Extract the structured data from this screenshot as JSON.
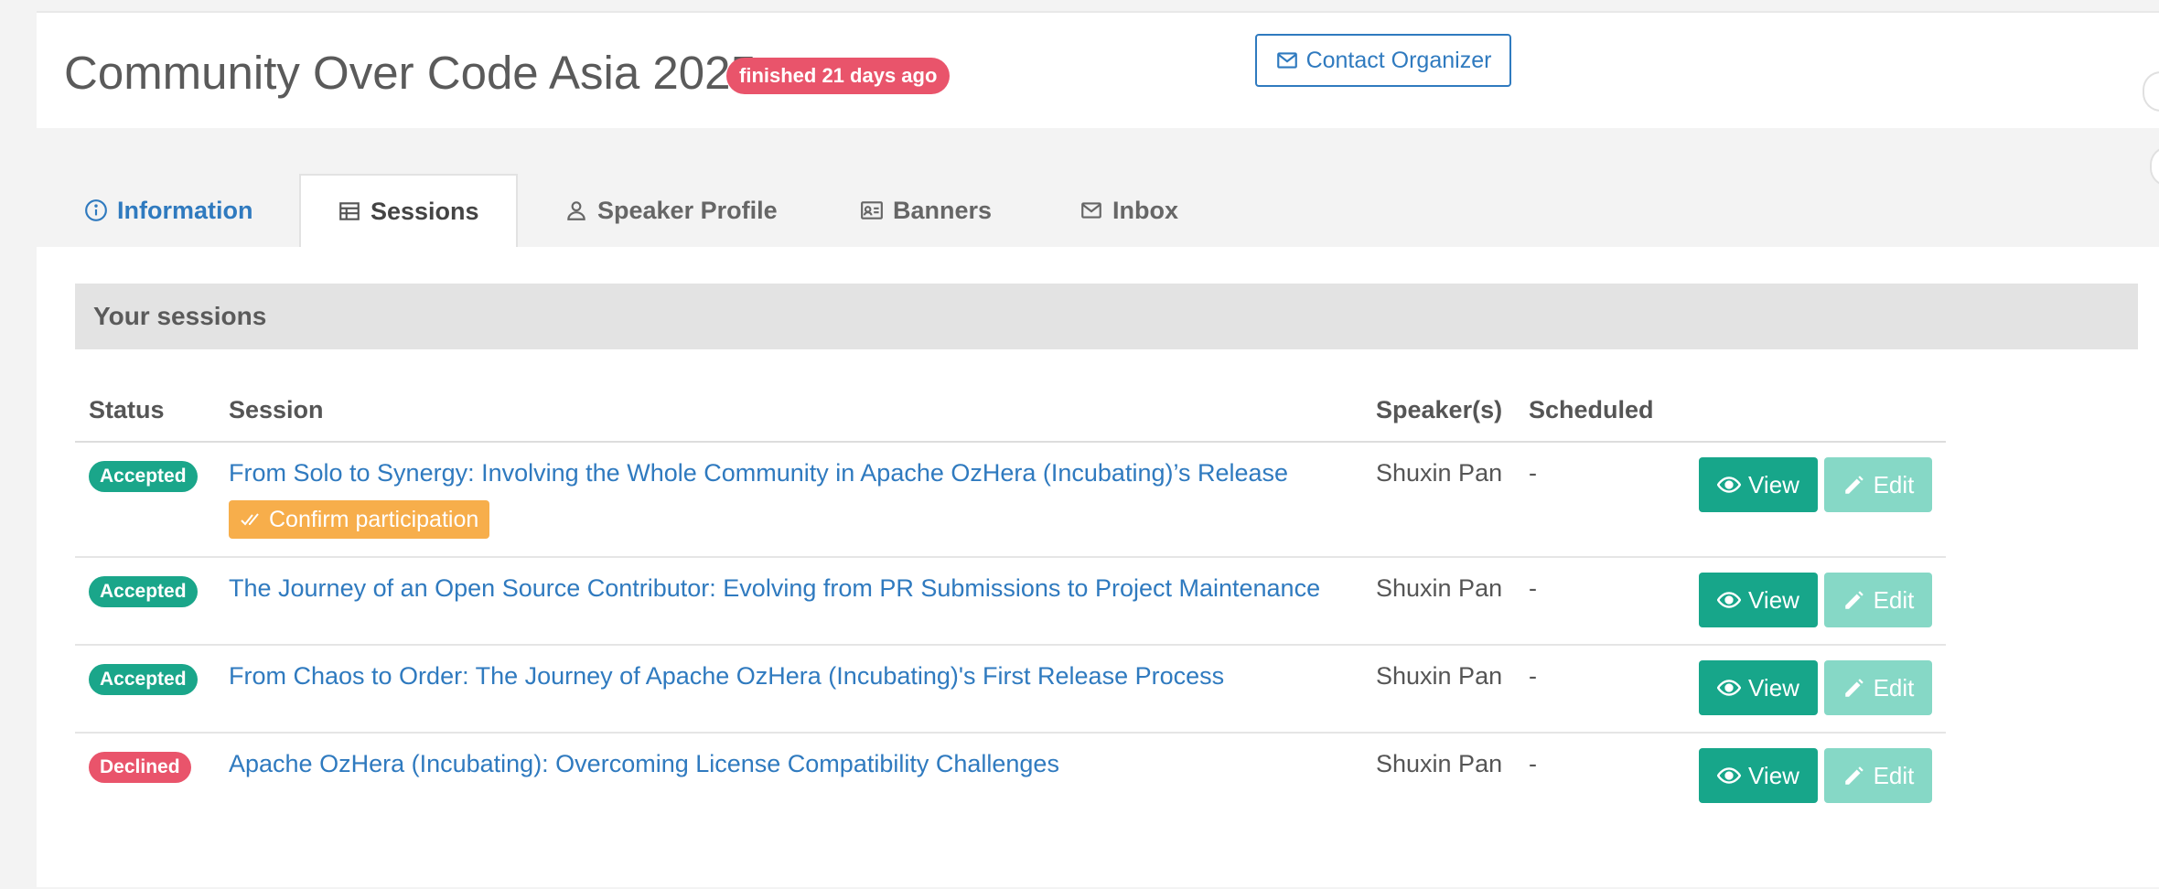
{
  "header": {
    "event_title": "Community Over Code Asia 2025",
    "status_pill": "finished 21 days ago",
    "contact_button": "Contact Organizer"
  },
  "tabs": [
    {
      "label": "Information",
      "icon": "info-icon"
    },
    {
      "label": "Sessions",
      "icon": "table-icon"
    },
    {
      "label": "Speaker Profile",
      "icon": "user-icon"
    },
    {
      "label": "Banners",
      "icon": "id-card-icon"
    },
    {
      "label": "Inbox",
      "icon": "envelope-icon"
    }
  ],
  "panel": {
    "heading": "Your sessions",
    "columns": {
      "status": "Status",
      "session": "Session",
      "speakers": "Speaker(s)",
      "scheduled": "Scheduled"
    },
    "confirm_label": "Confirm participation",
    "view_label": "View",
    "edit_label": "Edit",
    "rows": [
      {
        "status": "Accepted",
        "title": "From Solo to Synergy: Involving the Whole Community in Apache OzHera (Incubating)’s Release",
        "speaker": "Shuxin Pan",
        "scheduled": "-"
      },
      {
        "status": "Accepted",
        "title": "The Journey of an Open Source Contributor: Evolving from PR Submissions to Project Maintenance",
        "speaker": "Shuxin Pan",
        "scheduled": "-"
      },
      {
        "status": "Accepted",
        "title": "From Chaos to Order: The Journey of Apache OzHera (Incubating)'s First Release Process",
        "speaker": "Shuxin Pan",
        "scheduled": "-"
      },
      {
        "status": "Declined",
        "title": "Apache OzHera (Incubating): Overcoming License Compatibility Challenges",
        "speaker": "Shuxin Pan",
        "scheduled": "-"
      }
    ]
  },
  "colors": {
    "accent": "#2f7abf",
    "accepted": "#1aa68a",
    "declined": "#e9546b",
    "confirm": "#f7ae4b"
  }
}
